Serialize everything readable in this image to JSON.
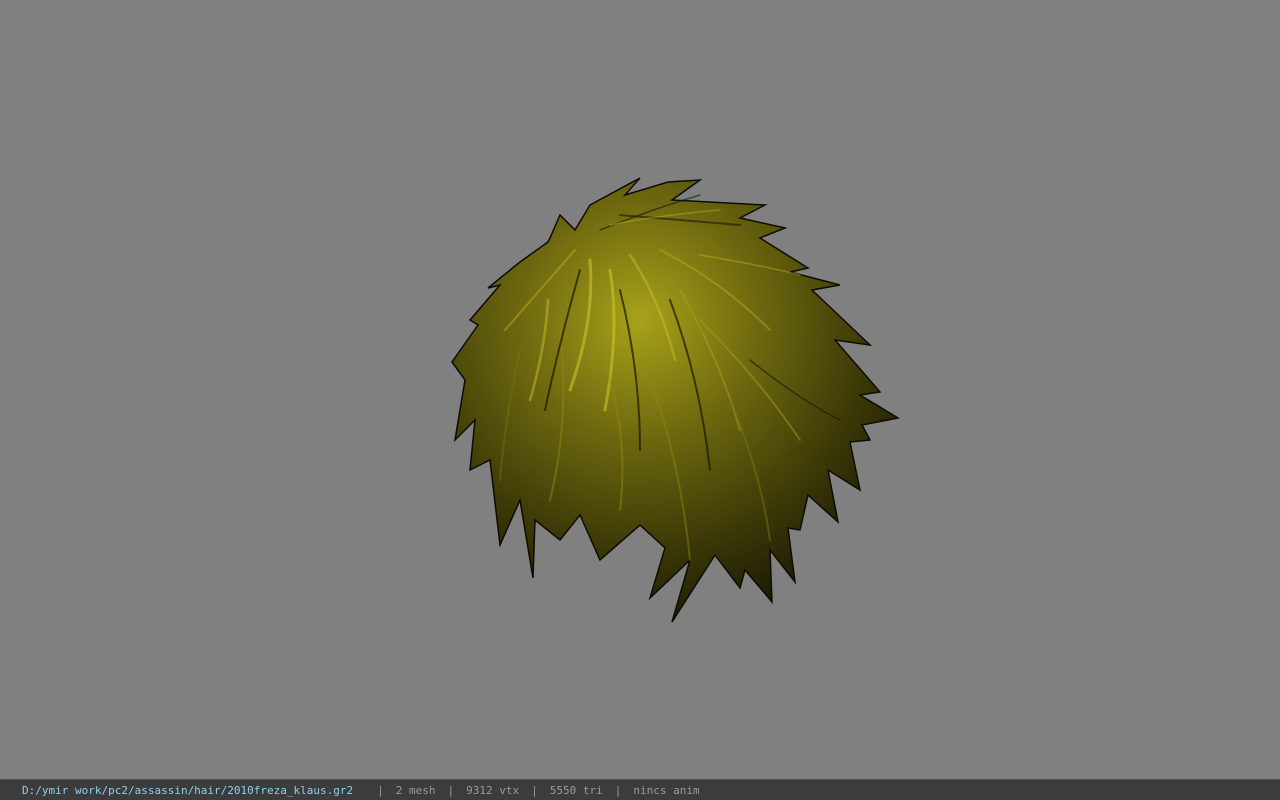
{
  "viewport": {
    "background_color": "#808080",
    "model": "hair-mesh",
    "hair_colors": {
      "dark": "#141203",
      "mid": "#4e4a0a",
      "light": "#a8a21a",
      "highlight": "#d2cb2c"
    }
  },
  "statusbar": {
    "file_path": "D:/ymir work/pc2/assassin/hair/2010freza_klaus.gr2",
    "separator": "|",
    "mesh": "2 mesh",
    "vertices": "9312 vtx",
    "triangles": "5550 tri",
    "anim": "nincs anim",
    "path_color": "#8fd0ea",
    "text_color": "#9a9a9a"
  }
}
